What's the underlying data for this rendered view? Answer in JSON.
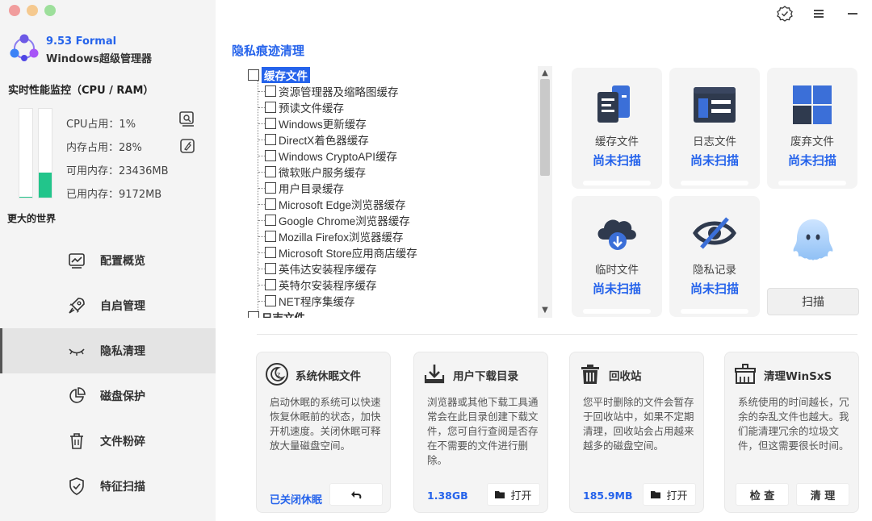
{
  "app": {
    "version": "9.53 Formal",
    "name": "Windows超级管理器"
  },
  "perf": {
    "title": "实时性能监控（CPU / RAM）",
    "cpu_label": "CPU占用：1%",
    "cpu_percent": 1,
    "mem_label": "内存占用：28%",
    "mem_percent": 28,
    "avail_label": "可用内存：23436MB",
    "used_label": "已用内存：9172MB"
  },
  "world_label": "更大的世界",
  "nav": [
    {
      "label": "配置概览",
      "icon": "chart-icon"
    },
    {
      "label": "自启管理",
      "icon": "rocket-icon"
    },
    {
      "label": "隐私清理",
      "icon": "closed-eye-icon"
    },
    {
      "label": "磁盘保护",
      "icon": "pie-icon"
    },
    {
      "label": "文件粉碎",
      "icon": "trash-icon"
    },
    {
      "label": "特征扫描",
      "icon": "shield-icon"
    }
  ],
  "section_title": "隐私痕迹清理",
  "tree": {
    "root": "缓存文件",
    "items": [
      "资源管理器及缩略图缓存",
      "预读文件缓存",
      "Windows更新缓存",
      "DirectX着色器缓存",
      "Windows CryptoAPI缓存",
      "微软账户服务缓存",
      "用户目录缓存",
      "Microsoft Edge浏览器缓存",
      "Google Chrome浏览器缓存",
      "Mozilla Firefox浏览器缓存",
      "Microsoft Store应用商店缓存",
      "英伟达安装程序缓存",
      "英特尔安装程序缓存",
      "NET程序集缓存"
    ],
    "next_root": "日志文件"
  },
  "scan_cards": [
    {
      "label": "缓存文件",
      "status": "尚未扫描"
    },
    {
      "label": "日志文件",
      "status": "尚未扫描"
    },
    {
      "label": "废弃文件",
      "status": "尚未扫描"
    },
    {
      "label": "临时文件",
      "status": "尚未扫描"
    },
    {
      "label": "隐私记录",
      "status": "尚未扫描"
    }
  ],
  "scan_button": "扫描",
  "bottom_cards": [
    {
      "title": "系统休眠文件",
      "desc": "启动休眠的系统可以快速恢复休眠前的状态，加快开机速度。关闭休眠可释放大量磁盘空间。",
      "value": "已关闭休眠",
      "button": ""
    },
    {
      "title": "用户下载目录",
      "desc": "浏览器或其他下载工具通常会在此目录创建下载文件，您可自行查阅是否存在不需要的文件进行删除。",
      "value": "1.38GB",
      "button": "打开"
    },
    {
      "title": "回收站",
      "desc": "您平时删除的文件会暂存于回收站中，如果不定期清理，回收站会占用越来越多的磁盘空间。",
      "value": "185.9MB",
      "button": "打开"
    },
    {
      "title": "清理WinSxS",
      "desc": "系统使用的时间越长，冗余的杂乱文件也越大。我们能清理冗余的垃圾文件，但这需要很长时间。",
      "button_check": "检 查",
      "button_clean": "清 理"
    }
  ],
  "colors": {
    "accent": "#2563eb",
    "green": "#22c58b",
    "sidebar_bg": "#f4f4f4"
  }
}
